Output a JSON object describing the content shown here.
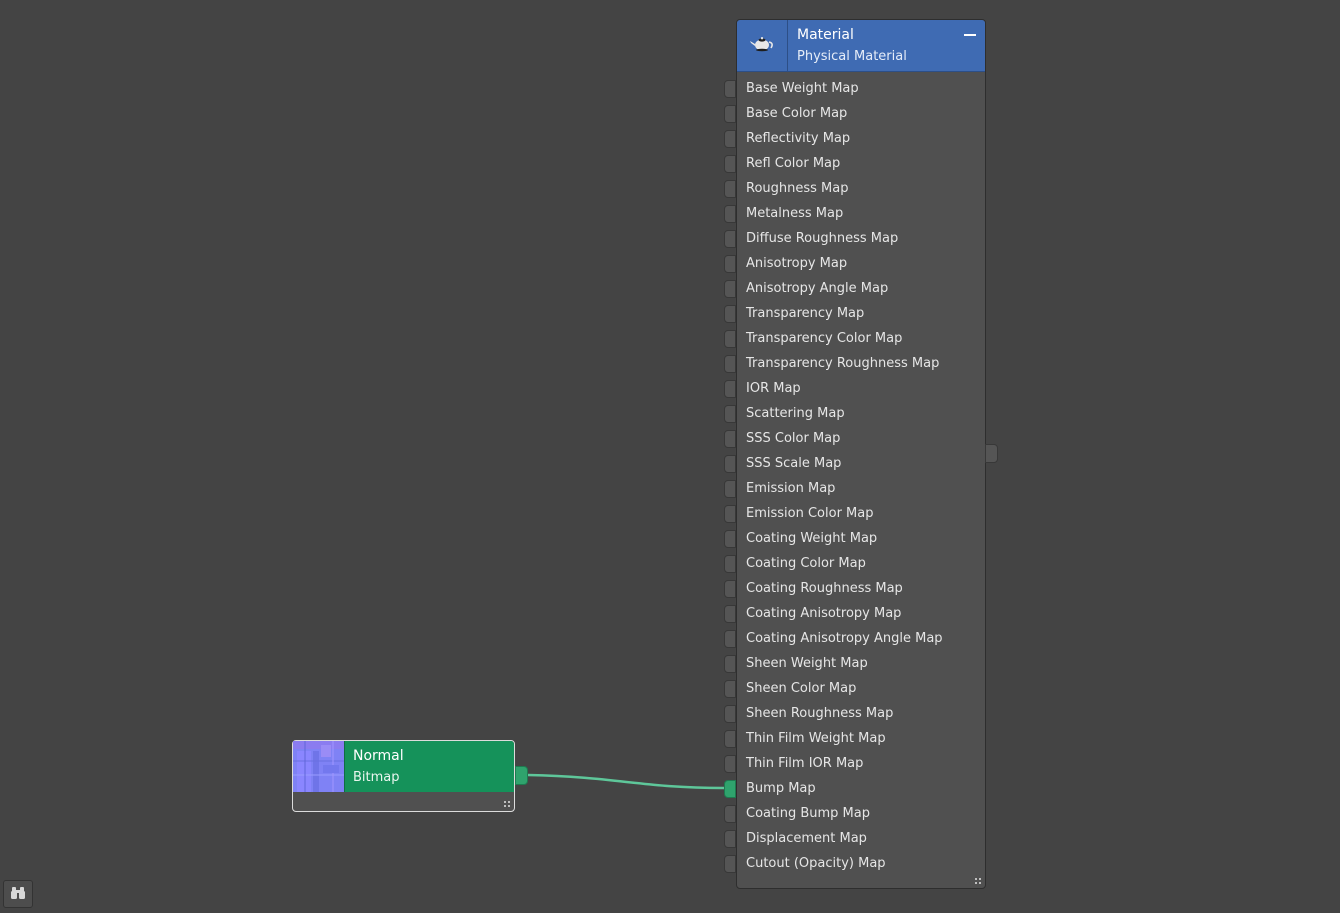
{
  "material_node": {
    "title": "Material",
    "subtitle": "Physical Material",
    "icon": "teapot-icon",
    "header_color": "#3f6bb3",
    "slots": [
      {
        "label": "Base Weight Map",
        "connected": false
      },
      {
        "label": "Base Color Map",
        "connected": false
      },
      {
        "label": "Reflectivity Map",
        "connected": false
      },
      {
        "label": "Refl Color Map",
        "connected": false
      },
      {
        "label": "Roughness Map",
        "connected": false
      },
      {
        "label": "Metalness Map",
        "connected": false
      },
      {
        "label": "Diffuse Roughness Map",
        "connected": false
      },
      {
        "label": "Anisotropy Map",
        "connected": false
      },
      {
        "label": "Anisotropy Angle Map",
        "connected": false
      },
      {
        "label": "Transparency Map",
        "connected": false
      },
      {
        "label": "Transparency Color Map",
        "connected": false
      },
      {
        "label": "Transparency Roughness Map",
        "connected": false
      },
      {
        "label": "IOR Map",
        "connected": false
      },
      {
        "label": "Scattering Map",
        "connected": false
      },
      {
        "label": "SSS Color Map",
        "connected": false
      },
      {
        "label": "SSS Scale Map",
        "connected": false
      },
      {
        "label": "Emission Map",
        "connected": false
      },
      {
        "label": "Emission Color Map",
        "connected": false
      },
      {
        "label": "Coating Weight Map",
        "connected": false
      },
      {
        "label": "Coating Color Map",
        "connected": false
      },
      {
        "label": "Coating Roughness Map",
        "connected": false
      },
      {
        "label": "Coating Anisotropy Map",
        "connected": false
      },
      {
        "label": "Coating Anisotropy Angle Map",
        "connected": false
      },
      {
        "label": "Sheen Weight Map",
        "connected": false
      },
      {
        "label": "Sheen Color Map",
        "connected": false
      },
      {
        "label": "Sheen Roughness Map",
        "connected": false
      },
      {
        "label": "Thin Film Weight Map",
        "connected": false
      },
      {
        "label": "Thin Film IOR Map",
        "connected": false
      },
      {
        "label": "Bump Map",
        "connected": true
      },
      {
        "label": "Coating Bump Map",
        "connected": false
      },
      {
        "label": "Displacement Map",
        "connected": false
      },
      {
        "label": "Cutout (Opacity) Map",
        "connected": false
      }
    ]
  },
  "bitmap_node": {
    "title": "Normal",
    "subtitle": "Bitmap",
    "header_color": "#15925a",
    "thumbnail": "normal-map-thumbnail"
  },
  "connection": {
    "from": "Normal",
    "to": "Bump Map",
    "wire_color": "#3fbf86"
  },
  "toolbar": {
    "search_icon": "binoculars-icon"
  }
}
